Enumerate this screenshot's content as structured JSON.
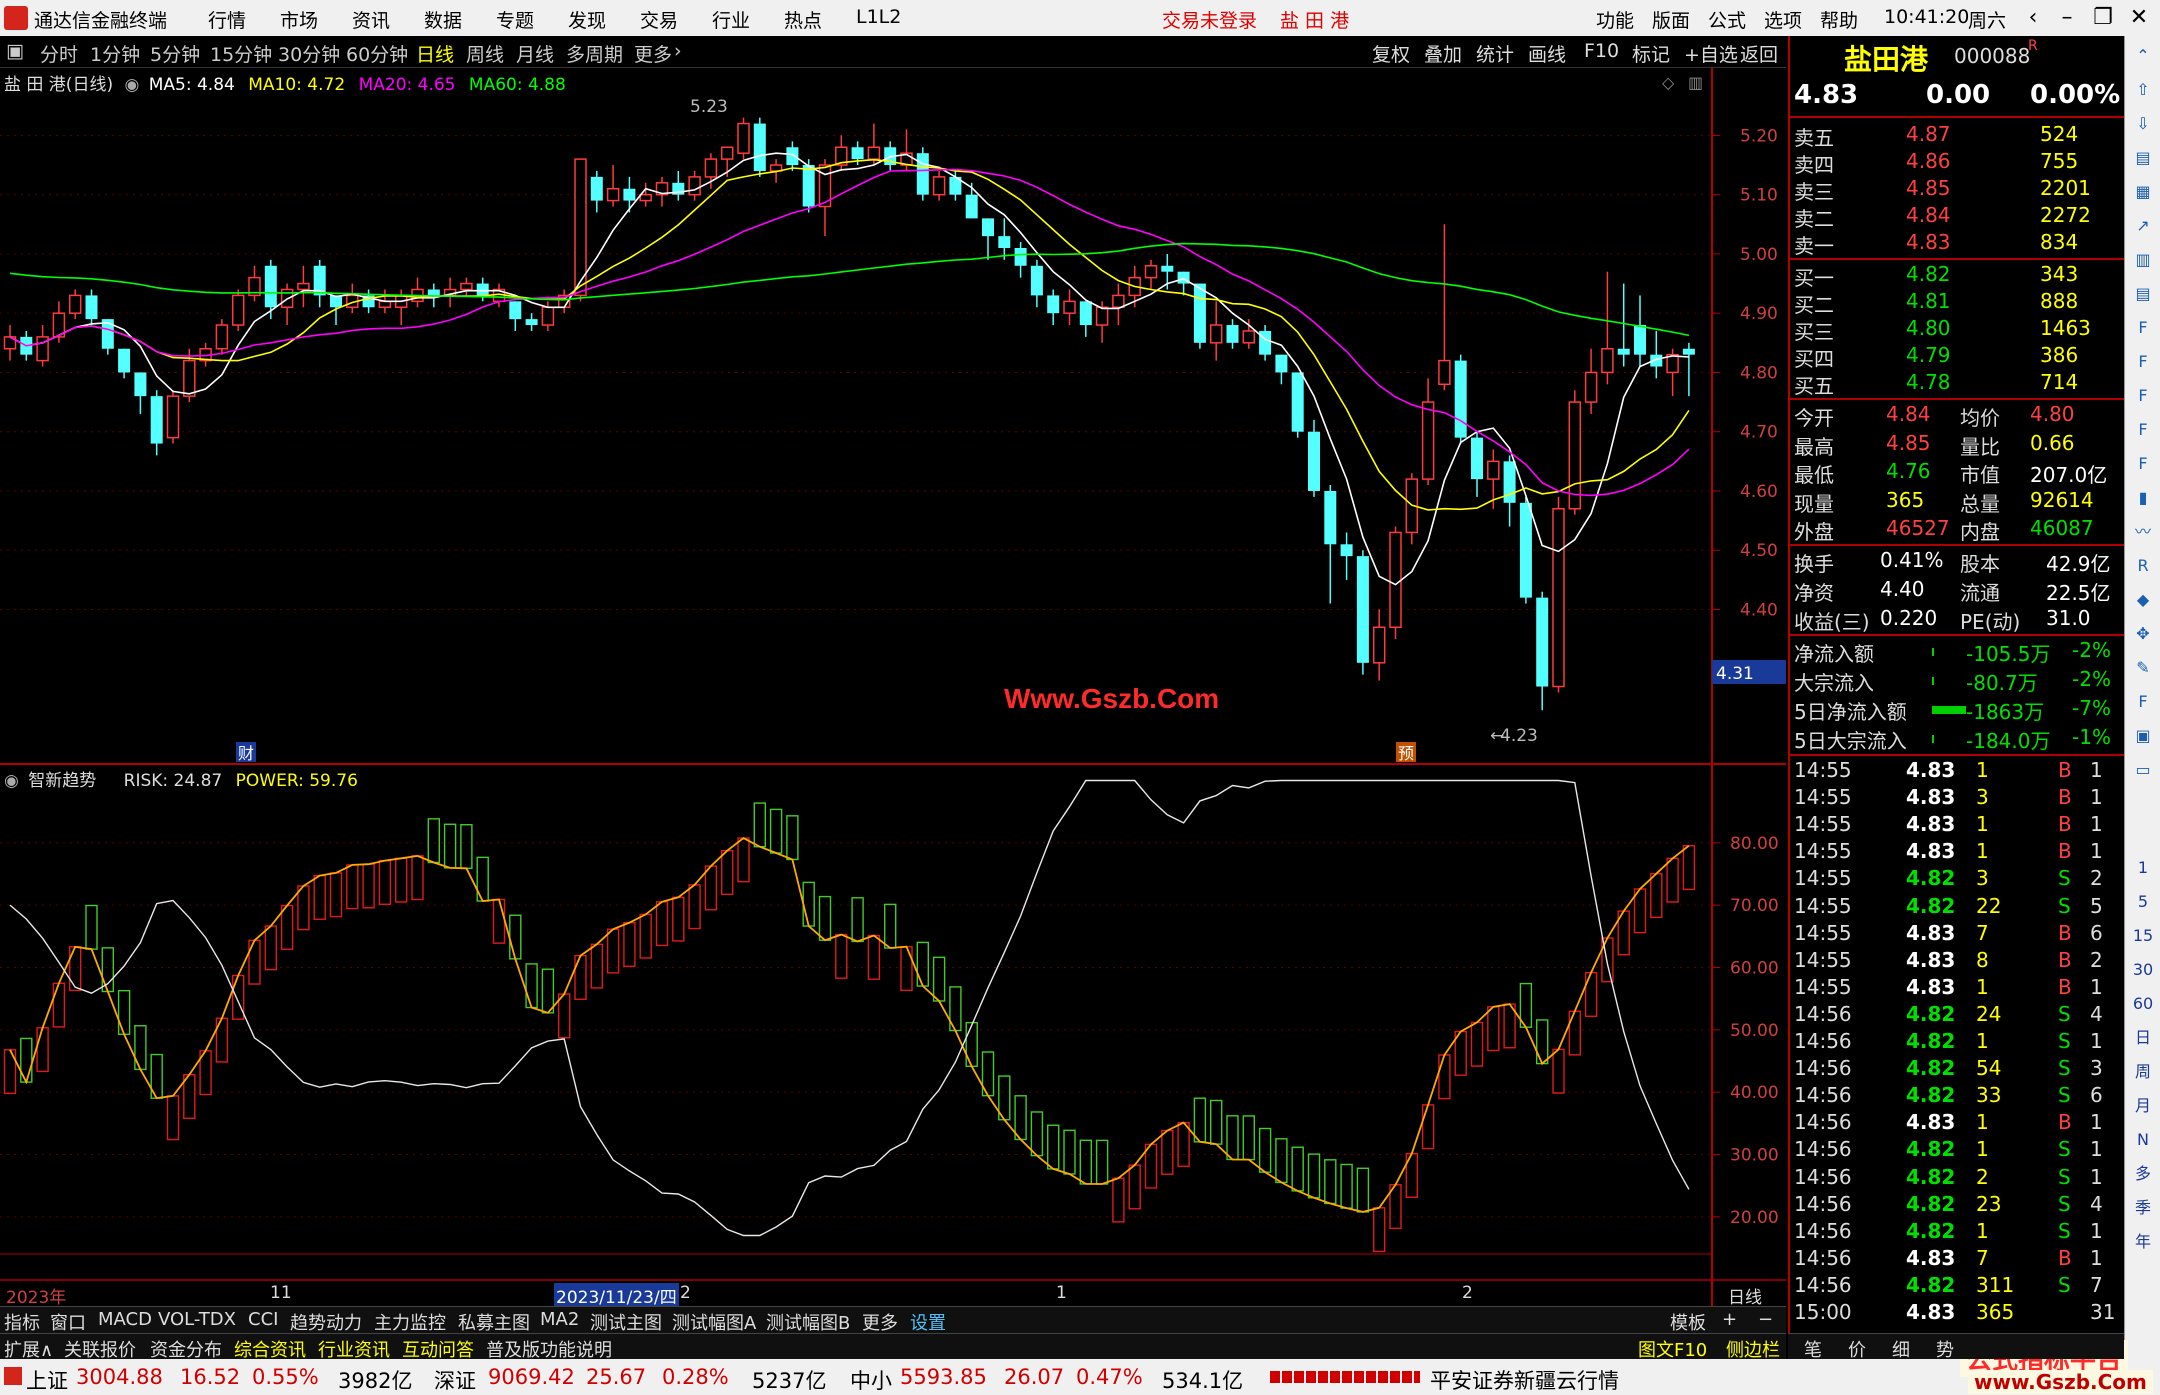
{
  "menu": {
    "app_title": "通达信金融终端",
    "items": [
      "行情",
      "市场",
      "资讯",
      "数据",
      "专题",
      "发现",
      "交易",
      "行业",
      "热点",
      "L1L2"
    ],
    "login_status": "交易未登录",
    "stock_name_title": "盐 田 港",
    "right_items": [
      "功能",
      "版面",
      "公式",
      "选项",
      "帮助"
    ],
    "time": "10:41:20",
    "weekday": "周六"
  },
  "period_bar": {
    "items": [
      "分时",
      "1分钟",
      "5分钟",
      "15分钟",
      "30分钟",
      "60分钟",
      "日线",
      "周线",
      "月线",
      "多周期",
      "更多"
    ],
    "active": "日线",
    "right_items": [
      "复权",
      "叠加",
      "统计",
      "画线",
      "F10",
      "标记",
      "+自选",
      "返回"
    ]
  },
  "main_chart": {
    "stock_label": "盐 田 港(日线)",
    "ma5": "MA5: 4.84",
    "ma10": "MA10: 4.72",
    "ma20": "MA20: 4.65",
    "ma60": "MA60: 4.88",
    "high_label": "5.23",
    "low_label": "4.23",
    "watermark": "Www.Gszb.Com",
    "marker_cai": "财",
    "marker_yu": "预",
    "price_cursor": "4.31",
    "colors": {
      "ma5": "#ffffff",
      "ma10": "#ffff00",
      "ma20": "#ff00ff",
      "ma60": "#00ff00",
      "up": "#ff3b3b",
      "down": "#54ffff"
    }
  },
  "sub_chart": {
    "name": "智新趋势",
    "risk": "RISK: 24.87",
    "power": "POWER: 59.76"
  },
  "time_axis": {
    "labels": [
      "2023年",
      "11",
      "2023/11/23/四",
      "2",
      "1",
      "2"
    ],
    "period": "日线"
  },
  "chart_data": {
    "type": "candlestick",
    "price_axis_ticks": [
      "5.20",
      "5.10",
      "5.00",
      "4.90",
      "4.80",
      "4.70",
      "4.60",
      "4.50",
      "4.40"
    ],
    "sub_axis_ticks": [
      "80.00",
      "70.00",
      "60.00",
      "50.00",
      "40.00",
      "30.00",
      "20.00"
    ],
    "ylim": [
      4.2,
      5.28
    ],
    "sub_ylim": [
      15,
      92
    ],
    "candles": [
      [
        4.84,
        4.86,
        4.88,
        4.82
      ],
      [
        4.86,
        4.83,
        4.87,
        4.82
      ],
      [
        4.82,
        4.86,
        4.88,
        4.81
      ],
      [
        4.86,
        4.9,
        4.92,
        4.85
      ],
      [
        4.9,
        4.93,
        4.94,
        4.89
      ],
      [
        4.93,
        4.89,
        4.94,
        4.88
      ],
      [
        4.89,
        4.84,
        4.89,
        4.83
      ],
      [
        4.84,
        4.8,
        4.84,
        4.79
      ],
      [
        4.8,
        4.76,
        4.8,
        4.73
      ],
      [
        4.76,
        4.68,
        4.77,
        4.66
      ],
      [
        4.69,
        4.76,
        4.77,
        4.68
      ],
      [
        4.76,
        4.82,
        4.84,
        4.75
      ],
      [
        4.82,
        4.84,
        4.85,
        4.81
      ],
      [
        4.84,
        4.88,
        4.89,
        4.83
      ],
      [
        4.88,
        4.93,
        4.94,
        4.87
      ],
      [
        4.93,
        4.96,
        4.98,
        4.92
      ],
      [
        4.98,
        4.91,
        4.99,
        4.89
      ],
      [
        4.91,
        4.94,
        4.95,
        4.88
      ],
      [
        4.94,
        4.95,
        4.98,
        4.91
      ],
      [
        4.98,
        4.93,
        4.99,
        4.91
      ],
      [
        4.93,
        4.91,
        4.93,
        4.88
      ],
      [
        4.91,
        4.93,
        4.95,
        4.9
      ],
      [
        4.93,
        4.91,
        4.94,
        4.9
      ],
      [
        4.91,
        4.92,
        4.94,
        4.9
      ],
      [
        4.91,
        4.93,
        4.94,
        4.88
      ],
      [
        4.92,
        4.94,
        4.96,
        4.91
      ],
      [
        4.94,
        4.93,
        4.95,
        4.91
      ],
      [
        4.93,
        4.94,
        4.96,
        4.91
      ],
      [
        4.94,
        4.95,
        4.96,
        4.93
      ],
      [
        4.95,
        4.93,
        4.96,
        4.92
      ],
      [
        4.92,
        4.94,
        4.95,
        4.91
      ],
      [
        4.92,
        4.89,
        4.92,
        4.87
      ],
      [
        4.89,
        4.88,
        4.9,
        4.87
      ],
      [
        4.88,
        4.91,
        4.92,
        4.87
      ],
      [
        4.91,
        4.93,
        4.94,
        4.9
      ],
      [
        4.93,
        5.16,
        5.16,
        4.92
      ],
      [
        5.13,
        5.09,
        5.14,
        5.07
      ],
      [
        5.09,
        5.11,
        5.15,
        5.08
      ],
      [
        5.11,
        5.09,
        5.13,
        5.07
      ],
      [
        5.09,
        5.1,
        5.12,
        5.08
      ],
      [
        5.1,
        5.12,
        5.13,
        5.08
      ],
      [
        5.12,
        5.1,
        5.14,
        5.09
      ],
      [
        5.1,
        5.13,
        5.14,
        5.09
      ],
      [
        5.13,
        5.16,
        5.17,
        5.11
      ],
      [
        5.16,
        5.18,
        5.18,
        5.13
      ],
      [
        5.17,
        5.22,
        5.23,
        5.16
      ],
      [
        5.22,
        5.14,
        5.23,
        5.13
      ],
      [
        5.14,
        5.15,
        5.16,
        5.12
      ],
      [
        5.18,
        5.15,
        5.19,
        5.14
      ],
      [
        5.15,
        5.08,
        5.16,
        5.07
      ],
      [
        5.08,
        5.15,
        5.16,
        5.03
      ],
      [
        5.15,
        5.18,
        5.2,
        5.14
      ],
      [
        5.18,
        5.16,
        5.19,
        5.15
      ],
      [
        5.16,
        5.18,
        5.22,
        5.15
      ],
      [
        5.18,
        5.15,
        5.19,
        5.14
      ],
      [
        5.15,
        5.17,
        5.21,
        5.14
      ],
      [
        5.17,
        5.1,
        5.18,
        5.09
      ],
      [
        5.1,
        5.13,
        5.14,
        5.09
      ],
      [
        5.13,
        5.1,
        5.14,
        5.09
      ],
      [
        5.1,
        5.06,
        5.12,
        5.06
      ],
      [
        5.06,
        5.03,
        5.06,
        4.99
      ],
      [
        5.03,
        5.01,
        5.06,
        4.99
      ],
      [
        5.01,
        4.98,
        5.02,
        4.96
      ],
      [
        4.98,
        4.93,
        4.99,
        4.91
      ],
      [
        4.93,
        4.9,
        4.94,
        4.88
      ],
      [
        4.9,
        4.92,
        4.94,
        4.88
      ],
      [
        4.92,
        4.88,
        4.92,
        4.86
      ],
      [
        4.88,
        4.91,
        4.92,
        4.85
      ],
      [
        4.91,
        4.93,
        4.95,
        4.88
      ],
      [
        4.93,
        4.96,
        4.98,
        4.91
      ],
      [
        4.96,
        4.98,
        4.99,
        4.94
      ],
      [
        4.98,
        4.97,
        5.0,
        4.94
      ],
      [
        4.97,
        4.95,
        4.97,
        4.93
      ],
      [
        4.95,
        4.85,
        4.95,
        4.84
      ],
      [
        4.85,
        4.88,
        4.92,
        4.82
      ],
      [
        4.88,
        4.85,
        4.89,
        4.84
      ],
      [
        4.85,
        4.87,
        4.89,
        4.84
      ],
      [
        4.87,
        4.83,
        4.88,
        4.82
      ],
      [
        4.83,
        4.8,
        4.83,
        4.78
      ],
      [
        4.8,
        4.7,
        4.8,
        4.69
      ],
      [
        4.7,
        4.6,
        4.72,
        4.59
      ],
      [
        4.6,
        4.51,
        4.61,
        4.41
      ],
      [
        4.51,
        4.49,
        4.53,
        4.45
      ],
      [
        4.49,
        4.31,
        4.5,
        4.29
      ],
      [
        4.31,
        4.37,
        4.4,
        4.28
      ],
      [
        4.37,
        4.53,
        4.54,
        4.35
      ],
      [
        4.53,
        4.62,
        4.63,
        4.51
      ],
      [
        4.62,
        4.75,
        4.79,
        4.61
      ],
      [
        4.78,
        4.82,
        5.05,
        4.77
      ],
      [
        4.82,
        4.69,
        4.83,
        4.68
      ],
      [
        4.69,
        4.62,
        4.7,
        4.59
      ],
      [
        4.62,
        4.65,
        4.67,
        4.57
      ],
      [
        4.65,
        4.58,
        4.66,
        4.54
      ],
      [
        4.58,
        4.42,
        4.59,
        4.41
      ],
      [
        4.42,
        4.27,
        4.43,
        4.23
      ],
      [
        4.27,
        4.57,
        4.59,
        4.26
      ],
      [
        4.57,
        4.75,
        4.77,
        4.56
      ],
      [
        4.75,
        4.8,
        4.84,
        4.73
      ],
      [
        4.8,
        4.84,
        4.97,
        4.78
      ],
      [
        4.84,
        4.83,
        4.95,
        4.81
      ],
      [
        4.88,
        4.83,
        4.93,
        4.81
      ],
      [
        4.83,
        4.81,
        4.87,
        4.79
      ],
      [
        4.8,
        4.83,
        4.84,
        4.76
      ],
      [
        4.84,
        4.83,
        4.85,
        4.76
      ]
    ]
  },
  "quote_panel": {
    "name": "盐田港",
    "code": "000088",
    "r_mark": "R",
    "price": "4.83",
    "change": "0.00",
    "change_pct": "0.00%",
    "asks": [
      [
        "卖五",
        "4.87",
        "524"
      ],
      [
        "卖四",
        "4.86",
        "755"
      ],
      [
        "卖三",
        "4.85",
        "2201"
      ],
      [
        "卖二",
        "4.84",
        "2272"
      ],
      [
        "卖一",
        "4.83",
        "834"
      ]
    ],
    "bids": [
      [
        "买一",
        "4.82",
        "343"
      ],
      [
        "买二",
        "4.81",
        "888"
      ],
      [
        "买三",
        "4.80",
        "1463"
      ],
      [
        "买四",
        "4.79",
        "386"
      ],
      [
        "买五",
        "4.78",
        "714"
      ]
    ],
    "stats": [
      [
        "今开",
        "4.84",
        "均价",
        "4.80"
      ],
      [
        "最高",
        "4.85",
        "量比",
        "0.66"
      ],
      [
        "最低",
        "4.76",
        "市值",
        "207.0亿"
      ],
      [
        "现量",
        "365",
        "总量",
        "92614"
      ],
      [
        "外盘",
        "46527",
        "内盘",
        "46087"
      ]
    ],
    "stats2": [
      [
        "换手",
        "0.41%",
        "股本",
        "42.9亿"
      ],
      [
        "净资",
        "4.40",
        "流通",
        "22.5亿"
      ],
      [
        "收益(三)",
        "0.220",
        "PE(动)",
        "31.0"
      ]
    ],
    "flows": [
      [
        "净流入额",
        "-105.5万",
        "-2%"
      ],
      [
        "大宗流入",
        "-80.7万",
        "-2%"
      ],
      [
        "5日净流入额",
        "-1863万",
        "-7%"
      ],
      [
        "5日大宗流入",
        "-184.0万",
        "-1%"
      ]
    ],
    "ticks": [
      [
        "14:55",
        "4.83",
        "1",
        "B",
        "1"
      ],
      [
        "14:55",
        "4.83",
        "3",
        "B",
        "1"
      ],
      [
        "14:55",
        "4.83",
        "1",
        "B",
        "1"
      ],
      [
        "14:55",
        "4.83",
        "1",
        "B",
        "1"
      ],
      [
        "14:55",
        "4.82",
        "3",
        "S",
        "2"
      ],
      [
        "14:55",
        "4.82",
        "22",
        "S",
        "5"
      ],
      [
        "14:55",
        "4.83",
        "7",
        "B",
        "6"
      ],
      [
        "14:55",
        "4.83",
        "8",
        "B",
        "2"
      ],
      [
        "14:55",
        "4.83",
        "1",
        "B",
        "1"
      ],
      [
        "14:56",
        "4.82",
        "24",
        "S",
        "4"
      ],
      [
        "14:56",
        "4.82",
        "1",
        "S",
        "1"
      ],
      [
        "14:56",
        "4.82",
        "54",
        "S",
        "3"
      ],
      [
        "14:56",
        "4.82",
        "33",
        "S",
        "6"
      ],
      [
        "14:56",
        "4.83",
        "1",
        "B",
        "1"
      ],
      [
        "14:56",
        "4.82",
        "1",
        "S",
        "1"
      ],
      [
        "14:56",
        "4.82",
        "2",
        "S",
        "1"
      ],
      [
        "14:56",
        "4.82",
        "23",
        "S",
        "4"
      ],
      [
        "14:56",
        "4.82",
        "1",
        "S",
        "1"
      ],
      [
        "14:56",
        "4.83",
        "7",
        "B",
        "1"
      ],
      [
        "14:56",
        "4.82",
        "311",
        "S",
        "7"
      ],
      [
        "15:00",
        "4.83",
        "365",
        "",
        "31"
      ]
    ]
  },
  "icon_column": [
    "up-arrow-icon",
    "up-icon",
    "down-icon",
    "compare-icon",
    "grid-icon",
    "line-icon",
    "candle-icon",
    "table-icon",
    "f10-icon",
    "f1-icon",
    "f3-icon",
    "f2-icon",
    "f4-icon",
    "f5-icon",
    "wave-icon",
    "rsi-icon",
    "logo-icon",
    "move-icon",
    "pen-icon",
    "fs-icon",
    "copy-icon",
    "layout-icon"
  ],
  "icon_text": [
    "1",
    "5",
    "15",
    "30",
    "60",
    "日",
    "周",
    "月",
    "N",
    "多",
    "季",
    "年"
  ],
  "bottom_tabs1": {
    "items": [
      "指标",
      "窗口",
      "MACD",
      "VOL-TDX",
      "CCI",
      "趋势动力",
      "主力监控",
      "私募主图",
      "MA2",
      "测试主图",
      "测试幅图A",
      "测试幅图B",
      "更多",
      "设置"
    ],
    "right": [
      "模板",
      "+",
      "−"
    ]
  },
  "bottom_tabs2": {
    "items": [
      "扩展∧",
      "关联报价",
      "资金分布",
      "综合资讯",
      "行业资讯",
      "互动问答",
      "普及版功能说明"
    ],
    "right": [
      "图文F10",
      "侧边栏《",
      "笔",
      "价",
      "细",
      "势"
    ]
  },
  "status": {
    "sh_label": "上证",
    "sh_value": "3004.88",
    "sh_change": "16.52",
    "sh_pct": "0.55%",
    "sh_amount": "3982亿",
    "sz_label": "深证",
    "sz_value": "9069.42",
    "sz_change": "25.67",
    "sz_pct": "0.28%",
    "sz_amount": "5237亿",
    "zx_label": "中小",
    "zx_value": "5593.85",
    "zx_change": "26.07",
    "zx_pct": "0.47%",
    "zx_amount": "534.1亿",
    "broker": "平安证券新疆云行情",
    "watermark": "公式指标平台",
    "watermark2": "www.Gszb.Com"
  }
}
